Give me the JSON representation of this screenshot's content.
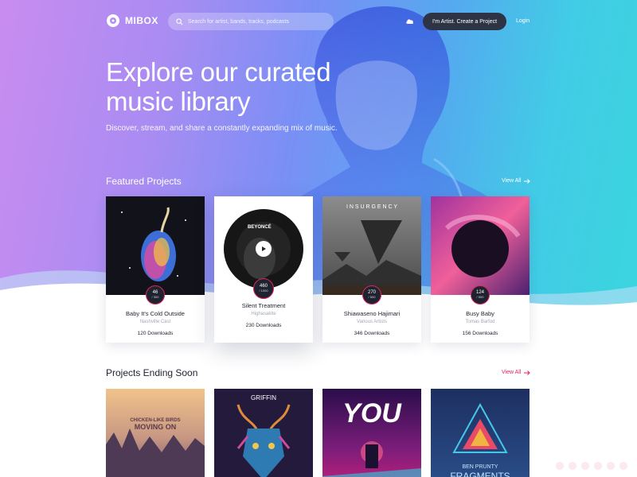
{
  "brand": {
    "name": "MIBOX"
  },
  "header": {
    "search_placeholder": "Search for artist, bands, tracks, podcasts",
    "cta_label": "I'm Artist. Create a Project",
    "login_label": "Login"
  },
  "hero": {
    "title": "Explore our curated music library",
    "subtitle": "Discover, stream, and share a constantly expanding mix of music."
  },
  "featured": {
    "title": "Featured Projects",
    "view_all": "View All",
    "cards": [
      {
        "title": "Baby It's Cold Outside",
        "artist": "Nashville Cast",
        "count": "46",
        "total": "/ 300",
        "downloads": "120 Downloads"
      },
      {
        "title": "Silent Treatment",
        "artist": "Highasakite",
        "count": "460",
        "total": "/ 1000",
        "downloads": "230 Downloads",
        "art_text": "BEYONCÉ"
      },
      {
        "title": "Shiawaseno Hajimari",
        "artist": "Various Artists",
        "count": "270",
        "total": "/ 500",
        "downloads": "346 Downloads",
        "art_text": "I N S U R G E N C Y"
      },
      {
        "title": "Busy Baby",
        "artist": "Tomas Barfod",
        "count": "124",
        "total": "/ 500",
        "downloads": "156 Downloads"
      }
    ]
  },
  "ending": {
    "title": "Projects Ending Soon",
    "view_all": "View All",
    "covers": [
      {
        "line1": "CHICKEN-LIKE BIRDS",
        "line2": "MOVING ON"
      },
      {
        "line1": "GRIFFIN"
      },
      {
        "line1": "YOU"
      },
      {
        "line1": "BEN PRUNTY",
        "line2": "FRAGMENTS"
      }
    ]
  },
  "colors": {
    "accent": "#e0245e",
    "dark": "#2d3445",
    "gradient_left": "#c98cf0",
    "gradient_right": "#3ad6de"
  }
}
